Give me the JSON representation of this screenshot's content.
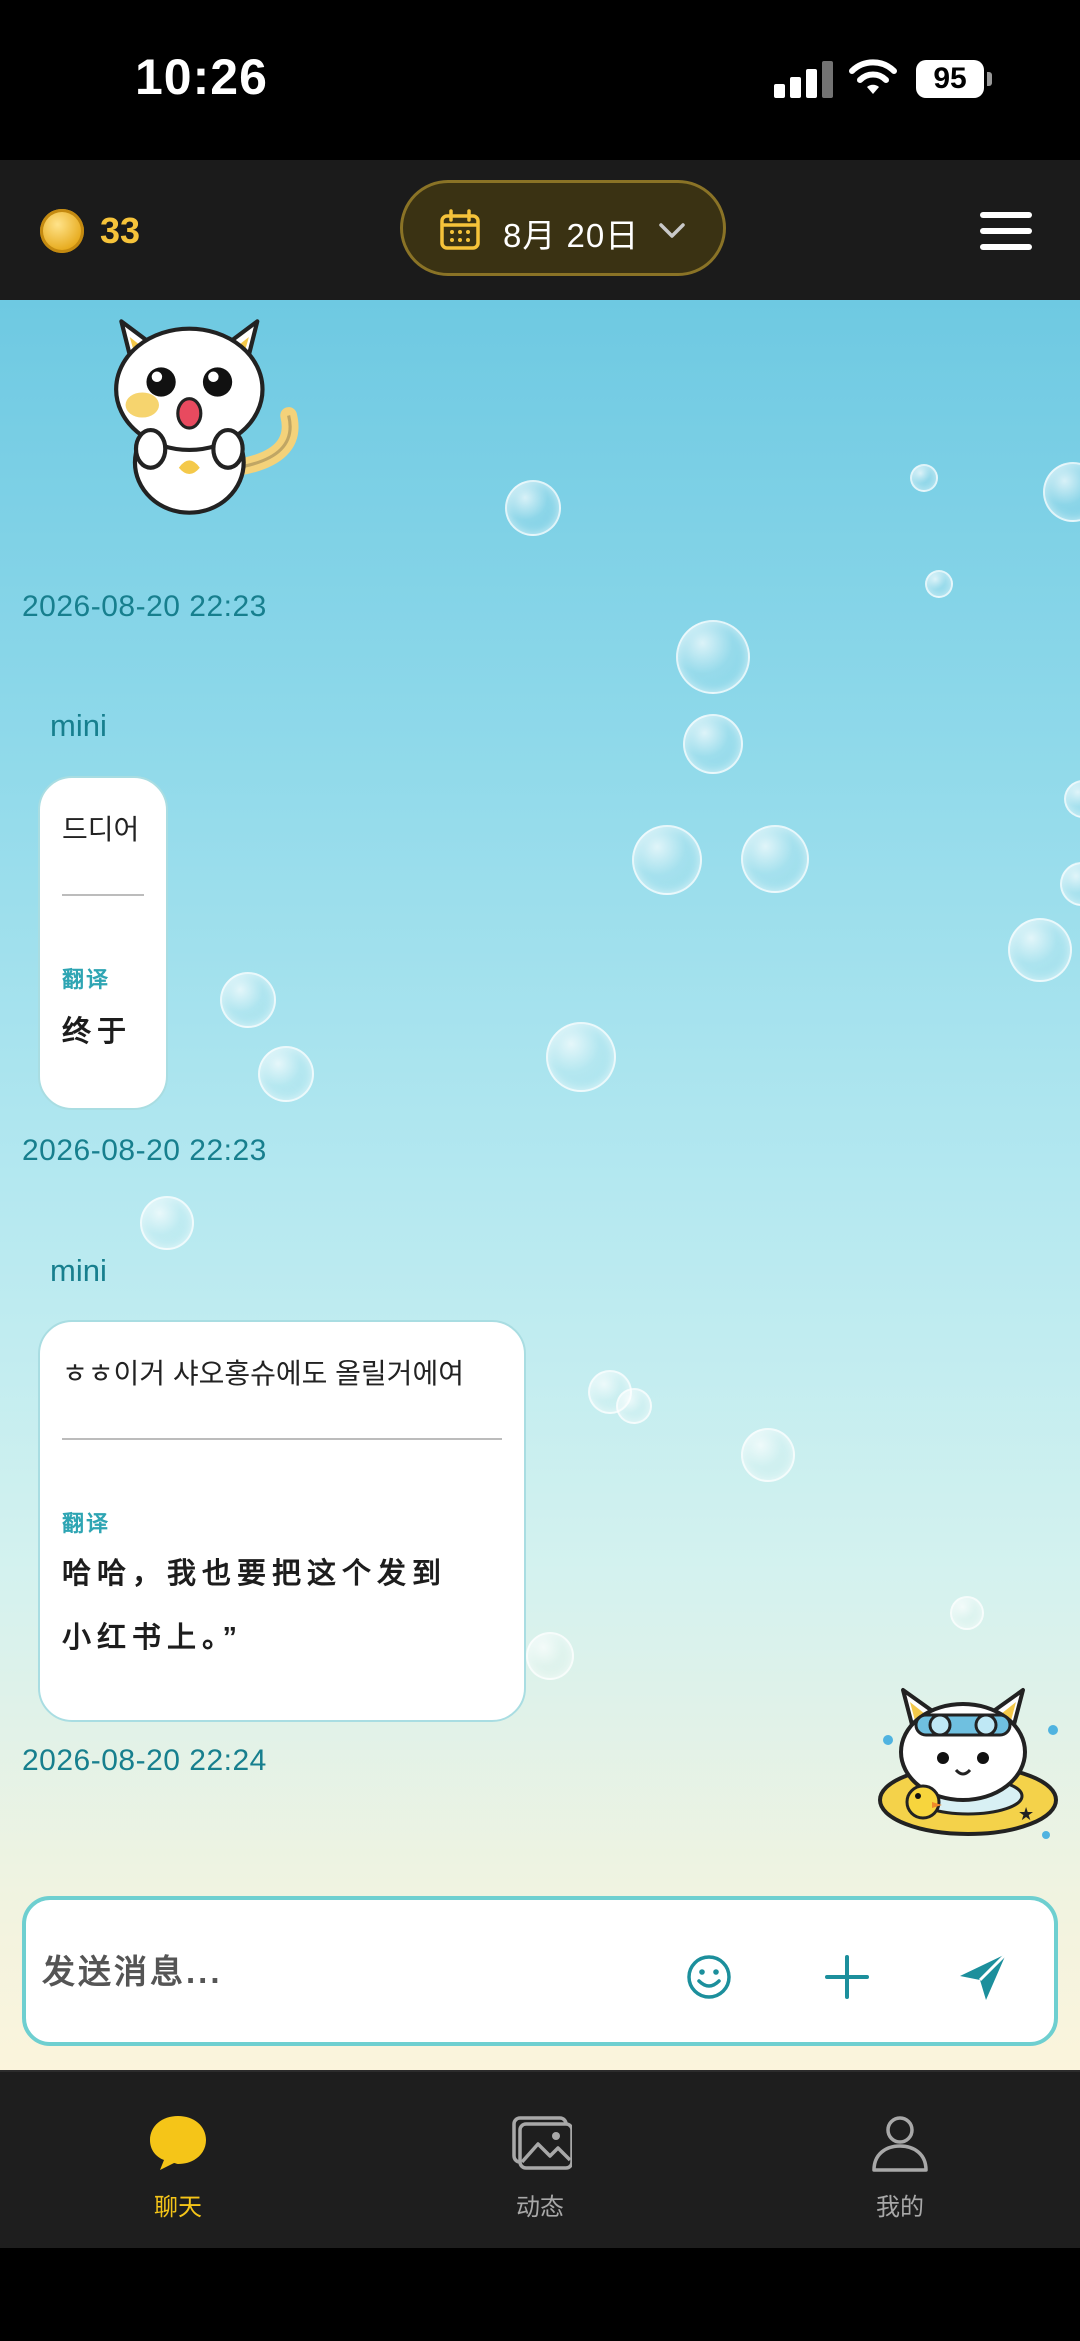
{
  "status_bar": {
    "time": "10:26",
    "battery": "95"
  },
  "header": {
    "coin_count": "33",
    "date_label": "8月 20日",
    "icons": {
      "coin": "coin-icon",
      "calendar": "calendar-icon",
      "chevron": "chevron-down-icon",
      "menu": "hamburger-menu-icon"
    },
    "accent_color": "#f6c33a"
  },
  "chat": {
    "messages": [
      {
        "timestamp": "2026-08-20 22:23"
      },
      {
        "sender": "mini",
        "original": "드디어",
        "translation_label": "翻译",
        "translation": "终于",
        "timestamp": "2026-08-20 22:23"
      },
      {
        "sender": "mini",
        "original": "ㅎㅎ이거 샤오홍슈에도 올릴거에여",
        "translation_label": "翻译",
        "translation_line1": "哈哈，我也要把这个发到",
        "translation_line2": "小红书上。”",
        "timestamp": "2026-08-20 22:24"
      }
    ],
    "stickers": [
      "cat-sticker",
      "swimming-cat-sticker"
    ]
  },
  "composer": {
    "placeholder": "发送消息...",
    "icons": {
      "emoji": "smiley-icon",
      "plus": "plus-icon",
      "send": "send-icon"
    },
    "border_color": "#6ecfd0"
  },
  "tabs": [
    {
      "label": "聊天",
      "icon": "chat-bubble-icon",
      "active": true
    },
    {
      "label": "动态",
      "icon": "gallery-icon",
      "active": false
    },
    {
      "label": "我的",
      "icon": "profile-icon",
      "active": false
    }
  ]
}
